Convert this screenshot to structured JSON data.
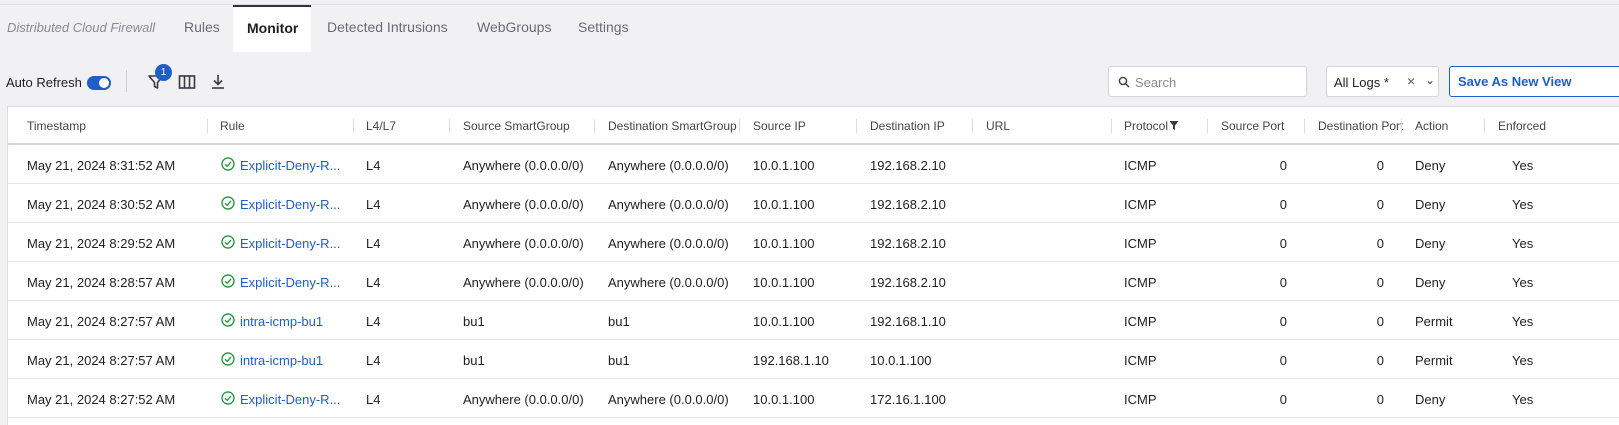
{
  "app": {
    "title": "Distributed Cloud Firewall"
  },
  "tabs": [
    {
      "label": "Rules",
      "active": false
    },
    {
      "label": "Monitor",
      "active": true
    },
    {
      "label": "Detected Intrusions",
      "active": false
    },
    {
      "label": "WebGroups",
      "active": false
    },
    {
      "label": "Settings",
      "active": false
    }
  ],
  "toolbar": {
    "auto_refresh_label": "Auto Refresh",
    "auto_refresh_on": true,
    "filter_count": "1",
    "search_placeholder": "Search",
    "log_view": "All Logs *",
    "clear_glyph": "×",
    "chevron_glyph": "⌄",
    "save_view_label": "Save As New View",
    "accent_color": "#1f5ec9"
  },
  "table": {
    "columns": [
      "Timestamp",
      "Rule",
      "L4/L7",
      "Source SmartGroup",
      "Destination SmartGroup",
      "Source IP",
      "Destination IP",
      "URL",
      "Protocol",
      "Source Port",
      "Destination Port",
      "Action",
      "Enforced"
    ],
    "rows": [
      {
        "timestamp": "May 21, 2024 8:31:52 AM",
        "rule": "Explicit-Deny-R...",
        "layer": "L4",
        "src_group": "Anywhere (0.0.0.0/0)",
        "dst_group": "Anywhere (0.0.0.0/0)",
        "src_ip": "10.0.1.100",
        "dst_ip": "192.168.2.10",
        "url": "",
        "protocol": "ICMP",
        "src_port": "0",
        "dst_port": "0",
        "action": "Deny",
        "enforced": "Yes"
      },
      {
        "timestamp": "May 21, 2024 8:30:52 AM",
        "rule": "Explicit-Deny-R...",
        "layer": "L4",
        "src_group": "Anywhere (0.0.0.0/0)",
        "dst_group": "Anywhere (0.0.0.0/0)",
        "src_ip": "10.0.1.100",
        "dst_ip": "192.168.2.10",
        "url": "",
        "protocol": "ICMP",
        "src_port": "0",
        "dst_port": "0",
        "action": "Deny",
        "enforced": "Yes"
      },
      {
        "timestamp": "May 21, 2024 8:29:52 AM",
        "rule": "Explicit-Deny-R...",
        "layer": "L4",
        "src_group": "Anywhere (0.0.0.0/0)",
        "dst_group": "Anywhere (0.0.0.0/0)",
        "src_ip": "10.0.1.100",
        "dst_ip": "192.168.2.10",
        "url": "",
        "protocol": "ICMP",
        "src_port": "0",
        "dst_port": "0",
        "action": "Deny",
        "enforced": "Yes"
      },
      {
        "timestamp": "May 21, 2024 8:28:57 AM",
        "rule": "Explicit-Deny-R...",
        "layer": "L4",
        "src_group": "Anywhere (0.0.0.0/0)",
        "dst_group": "Anywhere (0.0.0.0/0)",
        "src_ip": "10.0.1.100",
        "dst_ip": "192.168.2.10",
        "url": "",
        "protocol": "ICMP",
        "src_port": "0",
        "dst_port": "0",
        "action": "Deny",
        "enforced": "Yes"
      },
      {
        "timestamp": "May 21, 2024 8:27:57 AM",
        "rule": "intra-icmp-bu1",
        "layer": "L4",
        "src_group": "bu1",
        "dst_group": "bu1",
        "src_ip": "10.0.1.100",
        "dst_ip": "192.168.1.10",
        "url": "",
        "protocol": "ICMP",
        "src_port": "0",
        "dst_port": "0",
        "action": "Permit",
        "enforced": "Yes"
      },
      {
        "timestamp": "May 21, 2024 8:27:57 AM",
        "rule": "intra-icmp-bu1",
        "layer": "L4",
        "src_group": "bu1",
        "dst_group": "bu1",
        "src_ip": "192.168.1.10",
        "dst_ip": "10.0.1.100",
        "url": "",
        "protocol": "ICMP",
        "src_port": "0",
        "dst_port": "0",
        "action": "Permit",
        "enforced": "Yes"
      },
      {
        "timestamp": "May 21, 2024 8:27:52 AM",
        "rule": "Explicit-Deny-R...",
        "layer": "L4",
        "src_group": "Anywhere (0.0.0.0/0)",
        "dst_group": "Anywhere (0.0.0.0/0)",
        "src_ip": "10.0.1.100",
        "dst_ip": "172.16.1.100",
        "url": "",
        "protocol": "ICMP",
        "src_port": "0",
        "dst_port": "0",
        "action": "Deny",
        "enforced": "Yes"
      }
    ]
  }
}
